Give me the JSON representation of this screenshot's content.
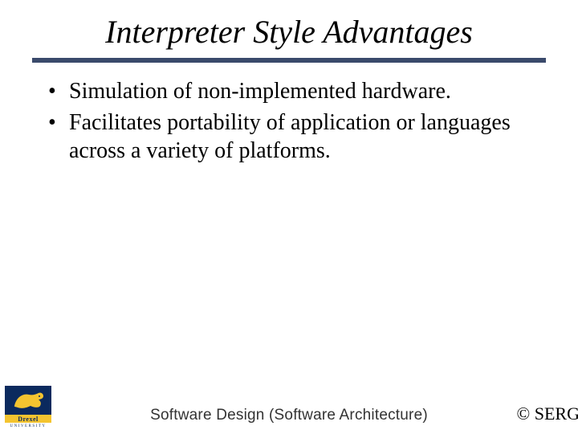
{
  "title": "Interpreter Style Advantages",
  "bullets": [
    "Simulation of non-implemented hardware.",
    "Facilitates portability of application or languages across a variety of platforms."
  ],
  "footer": {
    "center": "Software Design (Software Architecture)",
    "right": "© SERG"
  },
  "logo": {
    "name": "Drexel",
    "subtitle": "UNIVERSITY"
  }
}
